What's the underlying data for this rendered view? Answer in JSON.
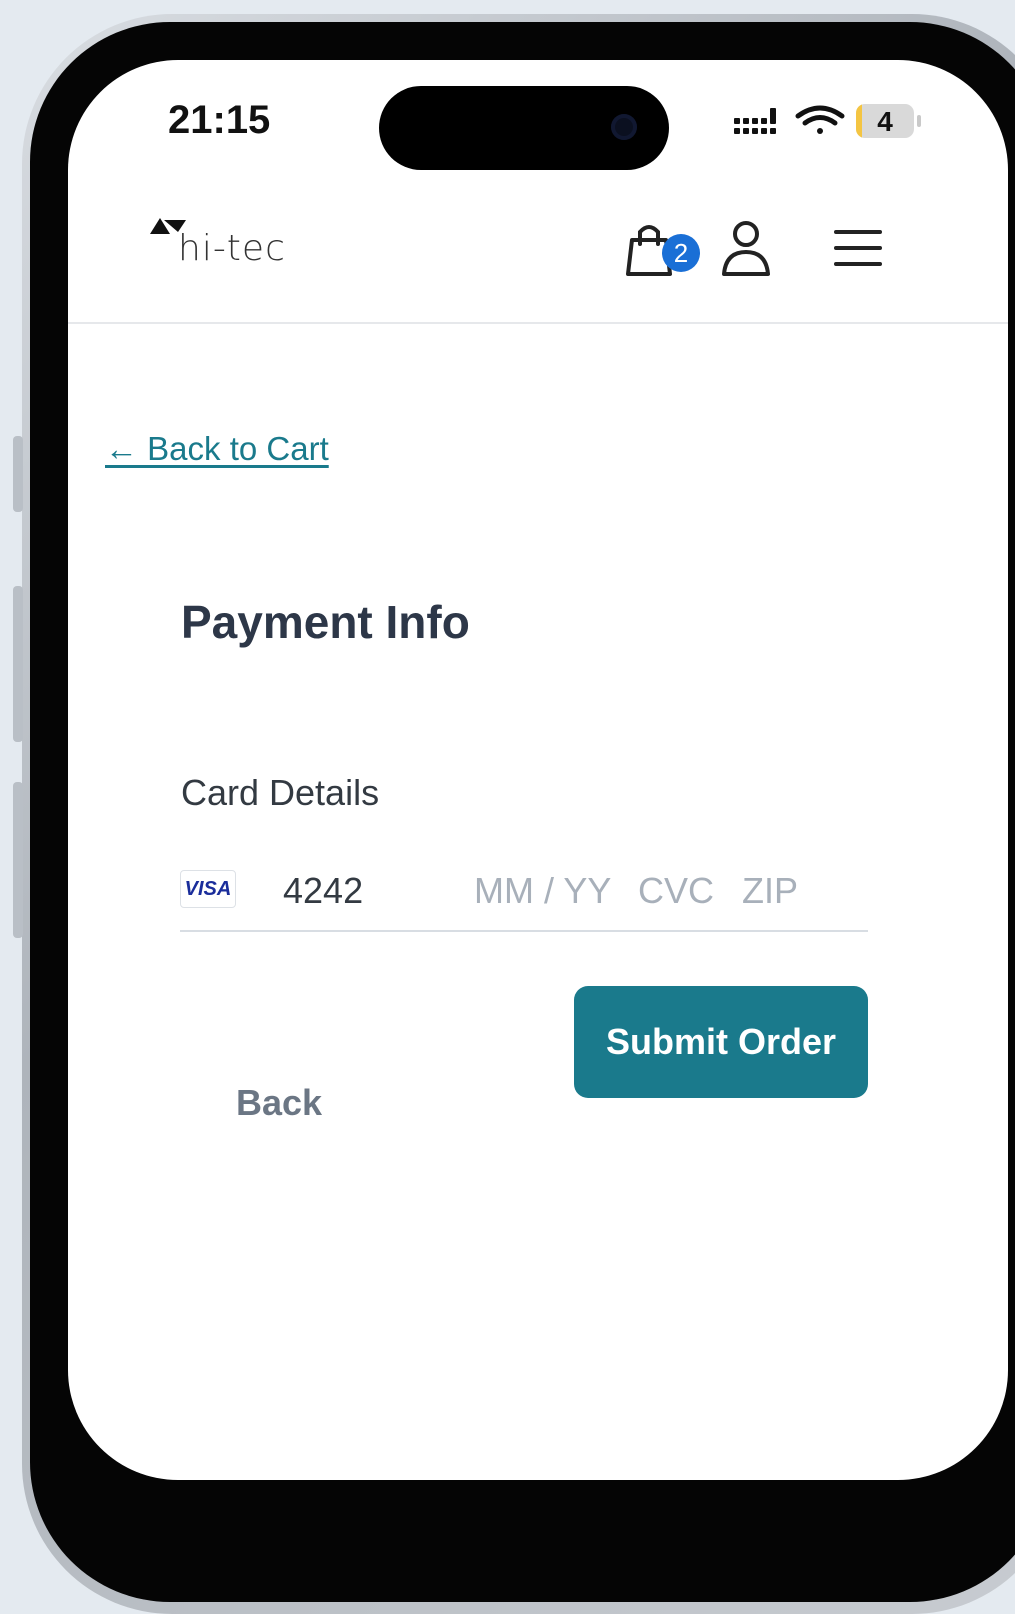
{
  "status_bar": {
    "time": "21:15",
    "battery": "4"
  },
  "header": {
    "logo_text": "hi-tec",
    "cart_count": "2"
  },
  "nav": {
    "back_to_cart": "← Back to Cart"
  },
  "payment": {
    "title": "Payment Info",
    "card_label": "Card Details",
    "card_brand": "VISA",
    "card_number": "4242",
    "expiry_placeholder": "MM / YY",
    "cvc_placeholder": "CVC",
    "zip_placeholder": "ZIP"
  },
  "actions": {
    "back_label": "Back",
    "submit_label": "Submit Order"
  },
  "colors": {
    "accent": "#1a7a8c",
    "badge": "#1a6fd6",
    "title": "#2d3748"
  },
  "icons": [
    "signal-icon",
    "wifi-icon",
    "battery-icon",
    "logo-icon",
    "cart-icon",
    "user-icon",
    "menu-icon",
    "visa-icon"
  ]
}
